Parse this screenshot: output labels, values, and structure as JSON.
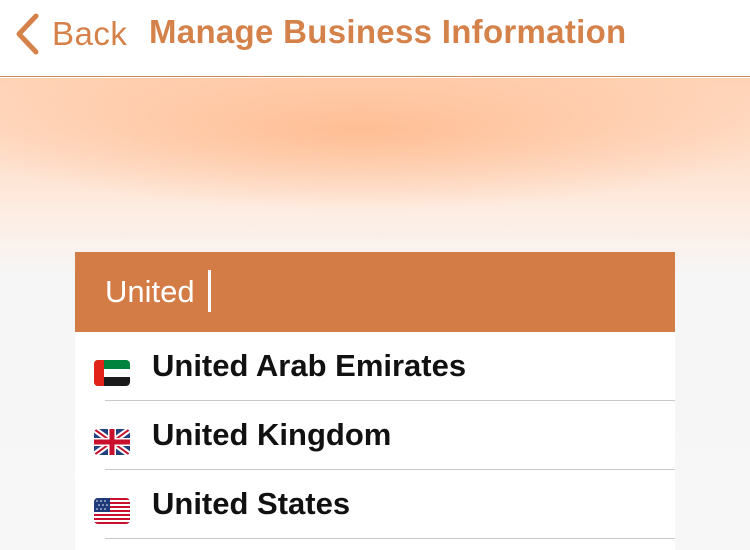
{
  "nav": {
    "back_label": "Back",
    "title": "Manage Business Information"
  },
  "search": {
    "value": "United"
  },
  "results": [
    {
      "name": "United Arab Emirates",
      "flag": "uae-flag-icon"
    },
    {
      "name": "United Kingdom",
      "flag": "uk-flag-icon"
    },
    {
      "name": "United States",
      "flag": "us-flag-icon"
    }
  ],
  "colors": {
    "accent": "#d4824a",
    "search_bg": "#d47c45"
  }
}
